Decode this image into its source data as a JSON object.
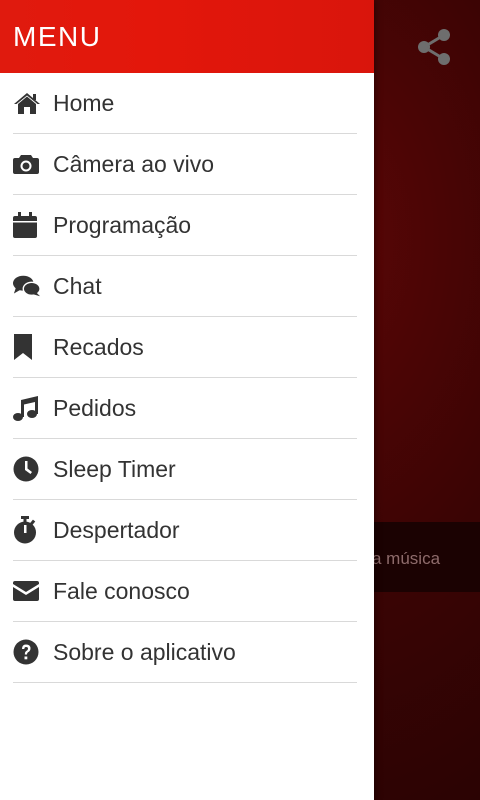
{
  "header": {
    "title": "MENU"
  },
  "menu": [
    {
      "label": "Home",
      "icon": "home-icon"
    },
    {
      "label": "Câmera ao vivo",
      "icon": "camera-icon"
    },
    {
      "label": "Programação",
      "icon": "calendar-icon"
    },
    {
      "label": "Chat",
      "icon": "chat-icon"
    },
    {
      "label": "Recados",
      "icon": "bookmark-icon"
    },
    {
      "label": "Pedidos",
      "icon": "music-note-icon"
    },
    {
      "label": "Sleep Timer",
      "icon": "clock-icon"
    },
    {
      "label": "Despertador",
      "icon": "stopwatch-icon"
    },
    {
      "label": "Fale conosco",
      "icon": "envelope-icon"
    },
    {
      "label": "Sobre o aplicativo",
      "icon": "question-circle-icon"
    }
  ],
  "background": {
    "now_playing_text": "a música"
  },
  "colors": {
    "accent": "#e3170b",
    "text": "#333333",
    "divider": "#d9d9d9"
  }
}
